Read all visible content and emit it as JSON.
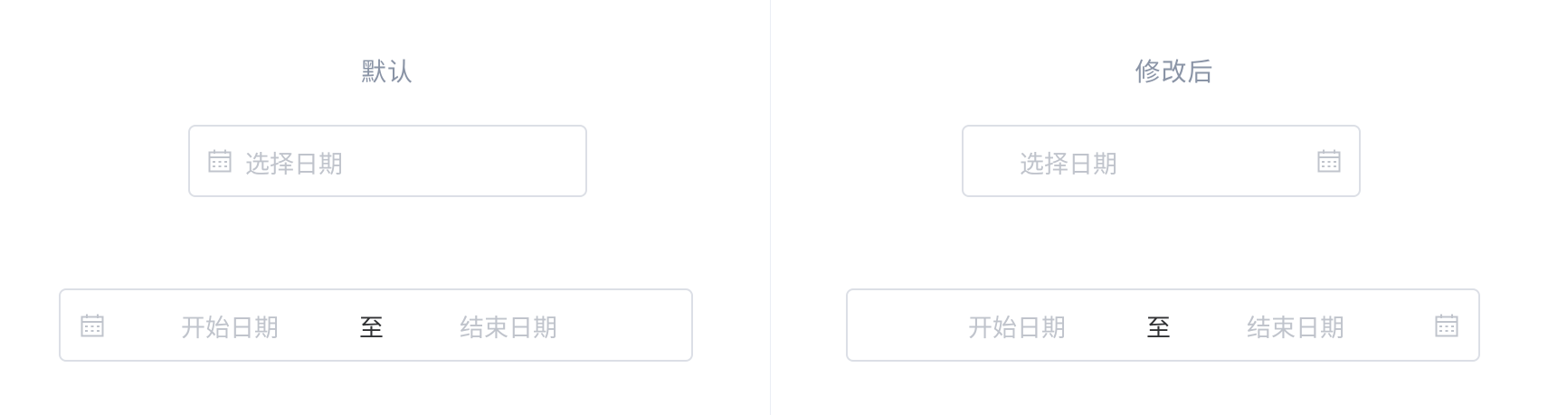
{
  "sections": {
    "default": {
      "title": "默认",
      "single": {
        "placeholder": "选择日期"
      },
      "range": {
        "start_placeholder": "开始日期",
        "separator": "至",
        "end_placeholder": "结束日期"
      }
    },
    "modified": {
      "title": "修改后",
      "single": {
        "placeholder": "选择日期"
      },
      "range": {
        "start_placeholder": "开始日期",
        "separator": "至",
        "end_placeholder": "结束日期"
      }
    }
  },
  "icons": {
    "calendar": "calendar-icon"
  },
  "colors": {
    "border": "#dcdfe6",
    "placeholder": "#c0c4cc",
    "title": "#8a94a6",
    "separator": "#303133",
    "divider": "#ebeef5"
  }
}
